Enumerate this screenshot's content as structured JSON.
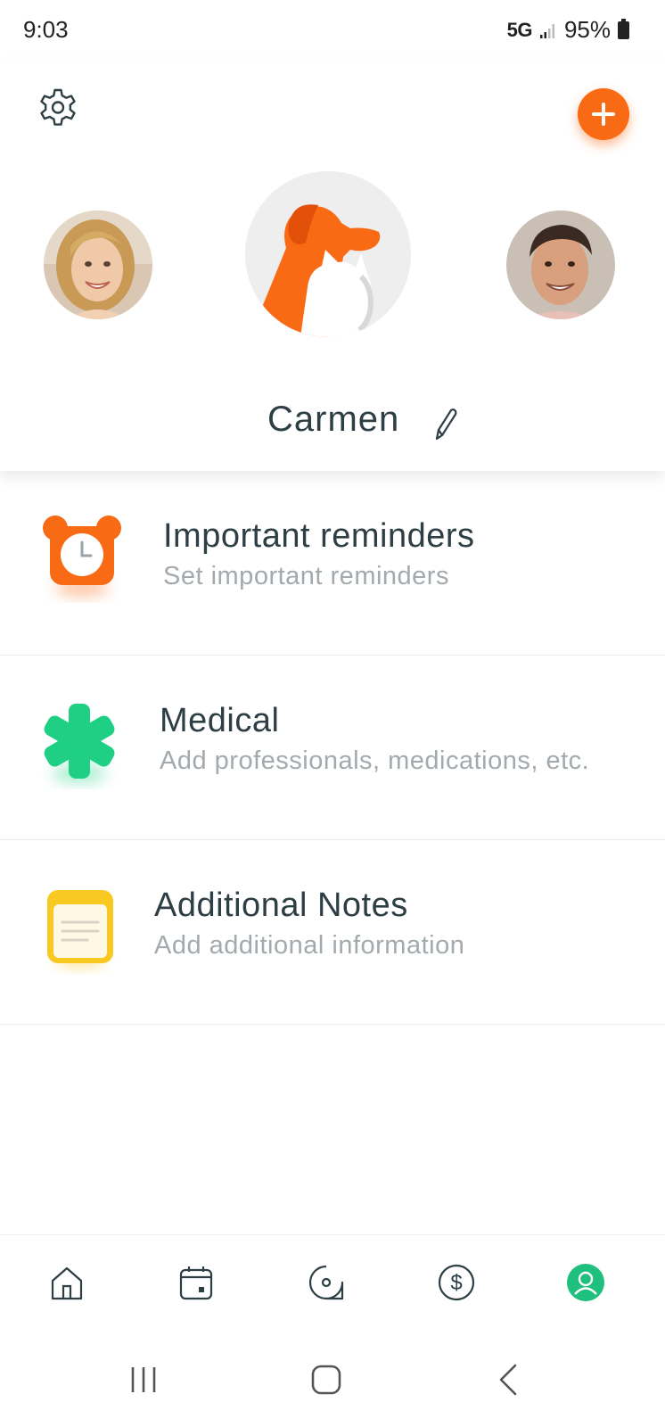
{
  "status_bar": {
    "time": "9:03",
    "network": "5G",
    "battery": "95%"
  },
  "profile": {
    "name": "Carmen",
    "accent_color": "#f96a14",
    "icons": {
      "settings": "gear-icon",
      "add": "plus-icon",
      "edit": "pencil-icon"
    }
  },
  "sections": [
    {
      "title": "Important reminders",
      "subtitle": "Set important reminders",
      "icon": "alarm-clock-icon",
      "color": "#f96a14"
    },
    {
      "title": "Medical",
      "subtitle": "Add professionals, medications, etc.",
      "icon": "medical-asterisk-icon",
      "color": "#1fd084"
    },
    {
      "title": "Additional Notes",
      "subtitle": "Add additional information",
      "icon": "notes-icon",
      "color": "#f9c923"
    }
  ],
  "tab_bar": {
    "tabs": [
      "home-icon",
      "calendar-icon",
      "location-icon",
      "dollar-icon",
      "profile-icon"
    ],
    "active": "profile-icon",
    "active_color": "#1fbf7e"
  },
  "system_nav": [
    "recents-icon",
    "home-button-icon",
    "back-icon"
  ]
}
